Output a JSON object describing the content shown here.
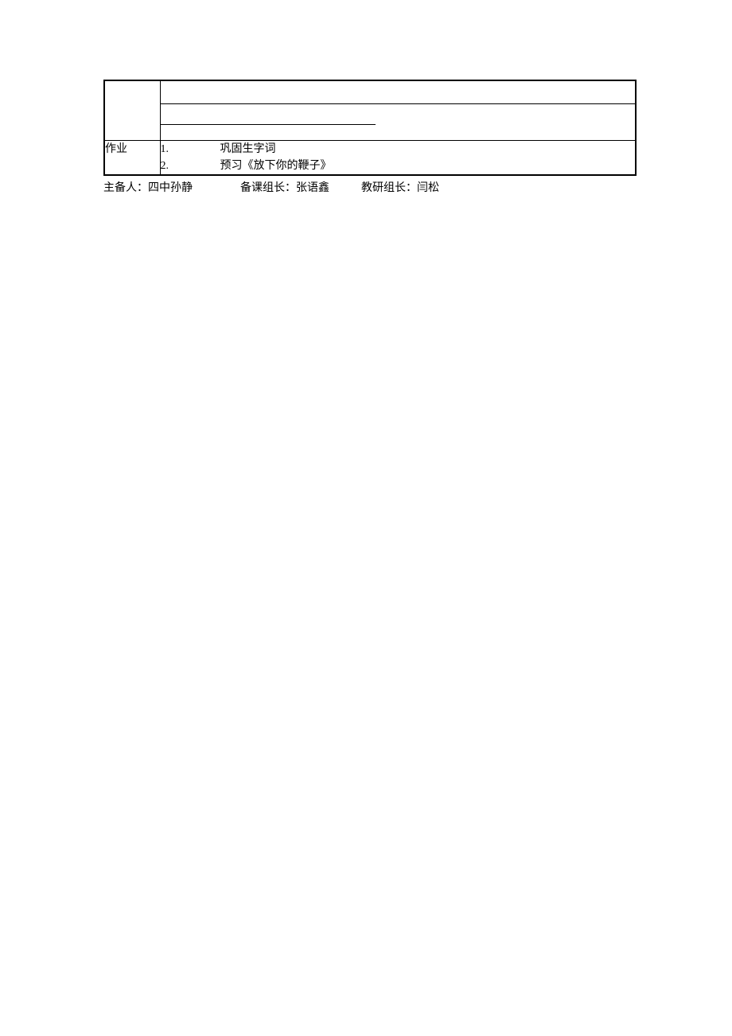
{
  "table": {
    "homework_label": "作业",
    "items": [
      {
        "num": "1.",
        "text": "巩固生字词"
      },
      {
        "num": "2.",
        "text": "预习《放下你的鞭子》"
      }
    ]
  },
  "footer": {
    "preparer_label": "主备人：",
    "preparer_value": "四中孙静",
    "group_leader_label": "备课组长：",
    "group_leader_value": "张语鑫",
    "research_leader_label": "教研组长：",
    "research_leader_value": "闫松"
  }
}
